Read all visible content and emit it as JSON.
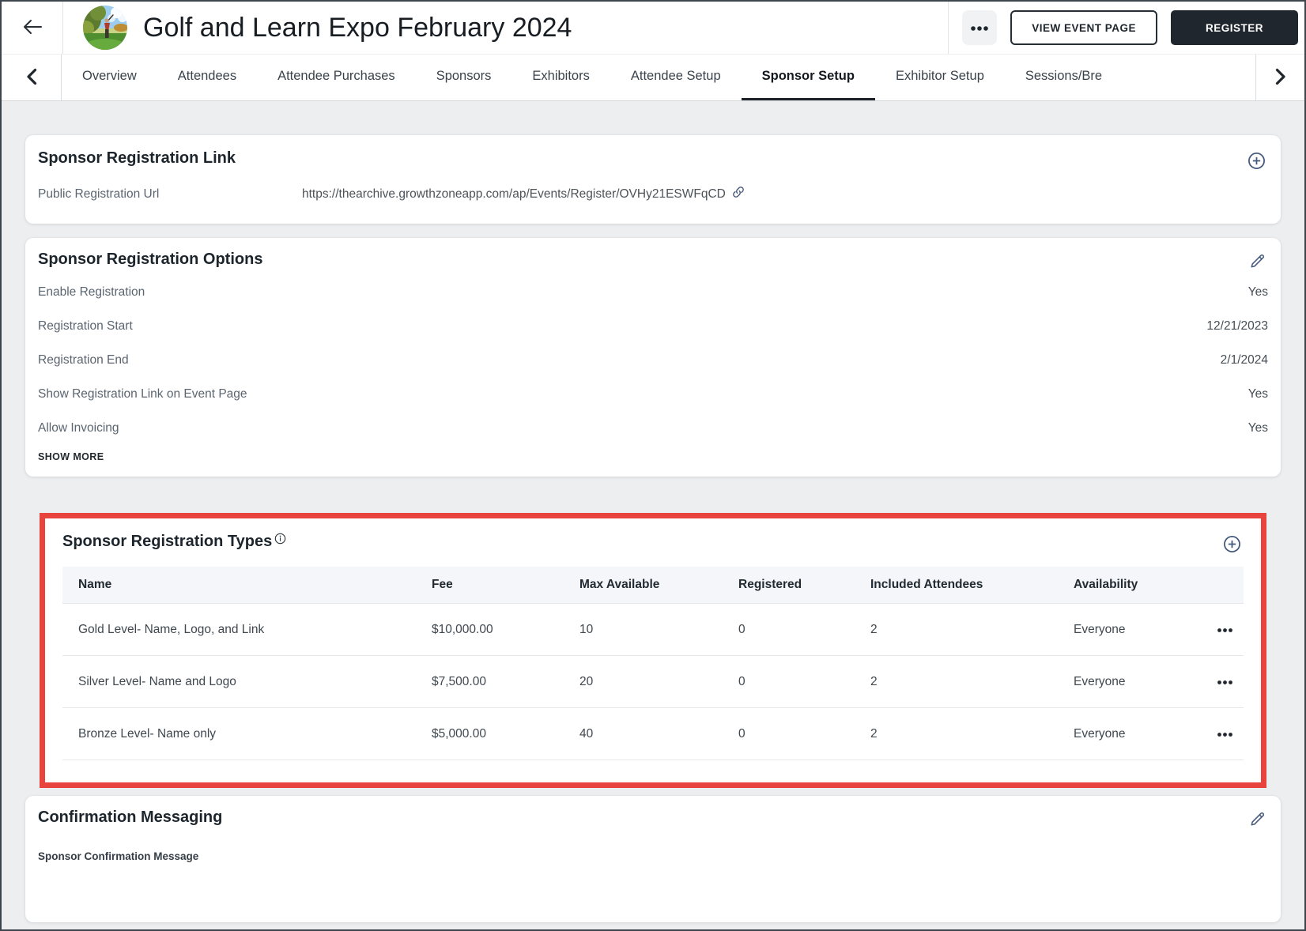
{
  "header": {
    "title": "Golf and Learn Expo February 2024",
    "view_event_label": "VIEW EVENT PAGE",
    "register_label": "REGISTER"
  },
  "tabs": {
    "items": [
      {
        "label": "Overview"
      },
      {
        "label": "Attendees"
      },
      {
        "label": "Attendee Purchases"
      },
      {
        "label": "Sponsors"
      },
      {
        "label": "Exhibitors"
      },
      {
        "label": "Attendee Setup"
      },
      {
        "label": "Sponsor Setup",
        "active": true
      },
      {
        "label": "Exhibitor Setup"
      },
      {
        "label": "Sessions/Bre"
      }
    ]
  },
  "registration_link": {
    "title": "Sponsor Registration Link",
    "url_label": "Public Registration Url",
    "url_value": "https://thearchive.growthzoneapp.com/ap/Events/Register/OVHy21ESWFqCD"
  },
  "registration_options": {
    "title": "Sponsor Registration Options",
    "rows": [
      {
        "label": "Enable Registration",
        "value": "Yes"
      },
      {
        "label": "Registration Start",
        "value": "12/21/2023"
      },
      {
        "label": "Registration End",
        "value": "2/1/2024"
      },
      {
        "label": "Show Registration Link on Event Page",
        "value": "Yes"
      },
      {
        "label": "Allow Invoicing",
        "value": "Yes"
      }
    ],
    "show_more_label": "SHOW MORE"
  },
  "registration_types": {
    "title": "Sponsor Registration Types",
    "columns": [
      "Name",
      "Fee",
      "Max Available",
      "Registered",
      "Included Attendees",
      "Availability"
    ],
    "rows": [
      {
        "name": "Gold Level- Name, Logo, and Link",
        "fee": "$10,000.00",
        "max_available": "10",
        "registered": "0",
        "included_attendees": "2",
        "availability": "Everyone"
      },
      {
        "name": "Silver Level- Name and Logo",
        "fee": "$7,500.00",
        "max_available": "20",
        "registered": "0",
        "included_attendees": "2",
        "availability": "Everyone"
      },
      {
        "name": "Bronze Level- Name only",
        "fee": "$5,000.00",
        "max_available": "40",
        "registered": "0",
        "included_attendees": "2",
        "availability": "Everyone"
      }
    ]
  },
  "confirmation": {
    "title": "Confirmation Messaging",
    "message_label": "Sponsor Confirmation Message"
  },
  "icons": {
    "back": "arrow-left-icon",
    "header_more": "ellipsis-icon",
    "tab_scroll_left": "chevron-left-icon",
    "tab_scroll_right": "chevron-right-icon",
    "add": "plus-circle-icon",
    "edit": "pencil-icon",
    "info": "info-circle-icon",
    "link": "link-icon",
    "row_menu": "ellipsis-icon"
  },
  "colors": {
    "annotation_red": "#e8433d",
    "primary_button_bg": "#20262e",
    "icon_accent": "#44597c",
    "active_tab_underline": "#1c2228"
  }
}
